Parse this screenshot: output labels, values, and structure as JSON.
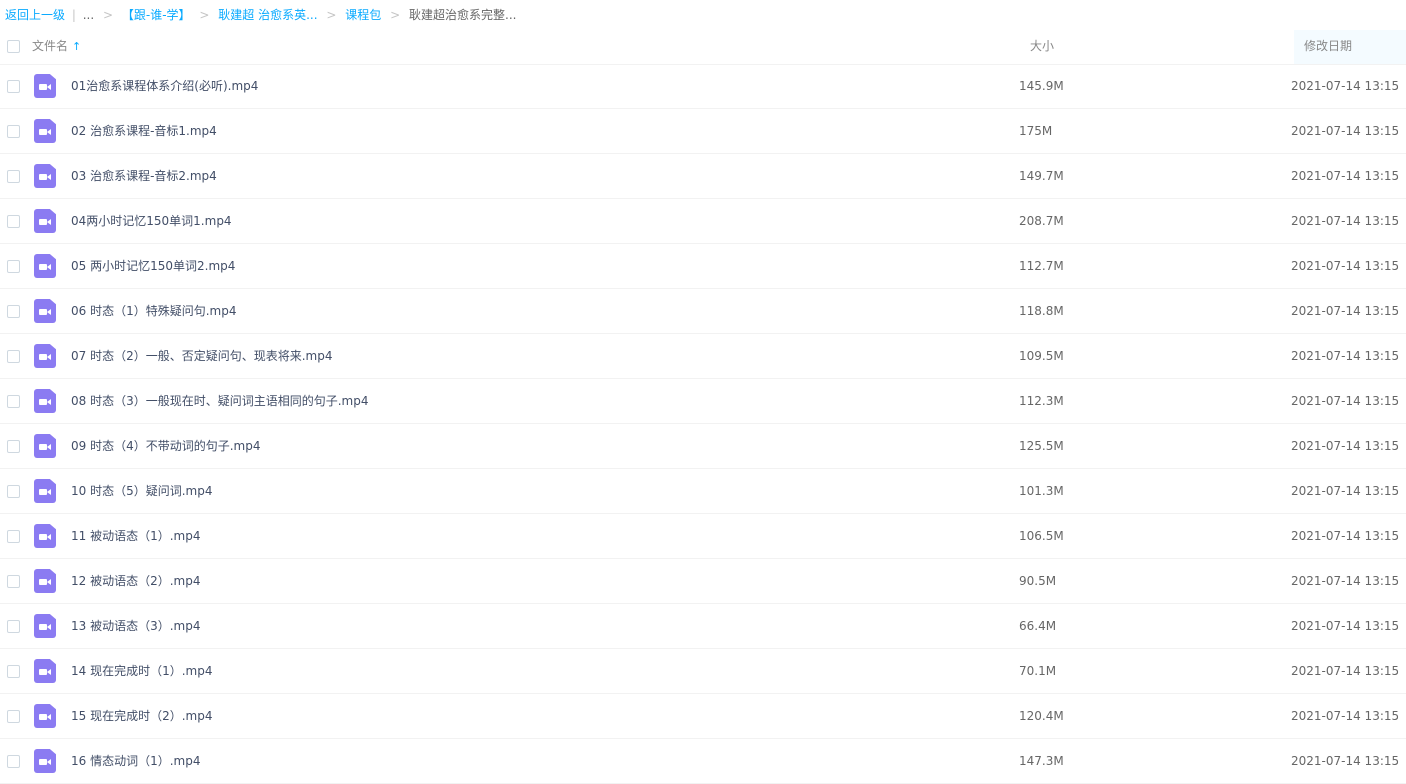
{
  "breadcrumb": {
    "back": "返回上一级",
    "divider": "|",
    "ellipsis": "...",
    "items": [
      "【跟-谁-学】",
      "耿建超 治愈系英...",
      "课程包"
    ],
    "current": "耿建超治愈系完整...",
    "sep": ">"
  },
  "header": {
    "name": "文件名",
    "sort_icon": "↑",
    "size": "大小",
    "date": "修改日期"
  },
  "icons": {
    "file": "video-file-icon",
    "color": "#8b7bf2"
  },
  "colors": {
    "link": "#09aaff",
    "date_column_bg": "#f4fbff"
  },
  "files": [
    {
      "name": "01治愈系课程体系介绍(必听).mp4",
      "size": "145.9M",
      "date": "2021-07-14 13:15"
    },
    {
      "name": "02 治愈系课程-音标1.mp4",
      "size": "175M",
      "date": "2021-07-14 13:15"
    },
    {
      "name": "03 治愈系课程-音标2.mp4",
      "size": "149.7M",
      "date": "2021-07-14 13:15"
    },
    {
      "name": "04两小时记忆150单词1.mp4",
      "size": "208.7M",
      "date": "2021-07-14 13:15"
    },
    {
      "name": "05 两小时记忆150单词2.mp4",
      "size": "112.7M",
      "date": "2021-07-14 13:15"
    },
    {
      "name": "06 时态（1）特殊疑问句.mp4",
      "size": "118.8M",
      "date": "2021-07-14 13:15"
    },
    {
      "name": "07 时态（2）一般、否定疑问句、现表将来.mp4",
      "size": "109.5M",
      "date": "2021-07-14 13:15"
    },
    {
      "name": "08 时态（3）一般现在时、疑问词主语相同的句子.mp4",
      "size": "112.3M",
      "date": "2021-07-14 13:15"
    },
    {
      "name": "09 时态（4）不带动词的句子.mp4",
      "size": "125.5M",
      "date": "2021-07-14 13:15"
    },
    {
      "name": "10 时态（5）疑问词.mp4",
      "size": "101.3M",
      "date": "2021-07-14 13:15"
    },
    {
      "name": "11 被动语态（1）.mp4",
      "size": "106.5M",
      "date": "2021-07-14 13:15"
    },
    {
      "name": "12 被动语态（2）.mp4",
      "size": "90.5M",
      "date": "2021-07-14 13:15"
    },
    {
      "name": "13 被动语态（3）.mp4",
      "size": "66.4M",
      "date": "2021-07-14 13:15"
    },
    {
      "name": "14 现在完成时（1）.mp4",
      "size": "70.1M",
      "date": "2021-07-14 13:15"
    },
    {
      "name": "15 现在完成时（2）.mp4",
      "size": "120.4M",
      "date": "2021-07-14 13:15"
    },
    {
      "name": "16 情态动词（1）.mp4",
      "size": "147.3M",
      "date": "2021-07-14 13:15"
    }
  ]
}
